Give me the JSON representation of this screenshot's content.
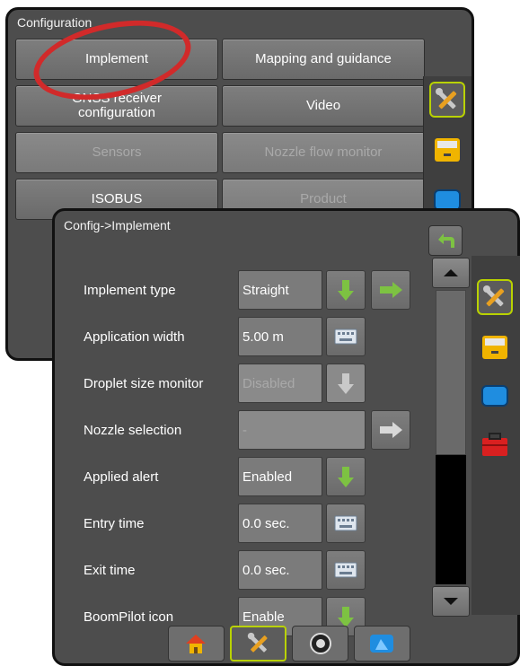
{
  "config_window": {
    "title": "Configuration",
    "buttons": [
      {
        "label": "Implement",
        "enabled": true
      },
      {
        "label": "Mapping and guidance",
        "enabled": true
      },
      {
        "label": "GNSS receiver\nconfiguration",
        "enabled": true
      },
      {
        "label": "Video",
        "enabled": true
      },
      {
        "label": "Sensors",
        "enabled": false
      },
      {
        "label": "Nozzle flow monitor",
        "enabled": false
      },
      {
        "label": "ISOBUS",
        "enabled": true
      },
      {
        "label": "Product",
        "enabled": false
      }
    ]
  },
  "implement_window": {
    "title": "Config->Implement",
    "rows": [
      {
        "label": "Implement type",
        "value": "Straight",
        "control": "dropdown+next"
      },
      {
        "label": "Application width",
        "value": "5.00 m",
        "control": "keyboard"
      },
      {
        "label": "Droplet size monitor",
        "value": "Disabled",
        "control": "dropdown-disabled"
      },
      {
        "label": "Nozzle selection",
        "value": "-",
        "control": "next"
      },
      {
        "label": "Applied alert",
        "value": "Enabled",
        "control": "dropdown"
      },
      {
        "label": "Entry time",
        "value": "0.0 sec.",
        "control": "keyboard"
      },
      {
        "label": "Exit time",
        "value": "0.0 sec.",
        "control": "keyboard"
      },
      {
        "label": "BoomPilot icon",
        "value": "Enable",
        "control": "dropdown"
      }
    ]
  },
  "colors": {
    "panel": "#4d4d4d",
    "accent_green": "#7dc242",
    "active_outline": "#b9d200",
    "highlight_circle": "#d12a2a"
  },
  "icons": {
    "side_tabs": [
      "tools-icon",
      "console-icon",
      "screen-icon",
      "toolbox-icon"
    ],
    "bottom_tabs": [
      "home-icon",
      "tools-icon",
      "camera-icon",
      "guidance-icon"
    ]
  }
}
